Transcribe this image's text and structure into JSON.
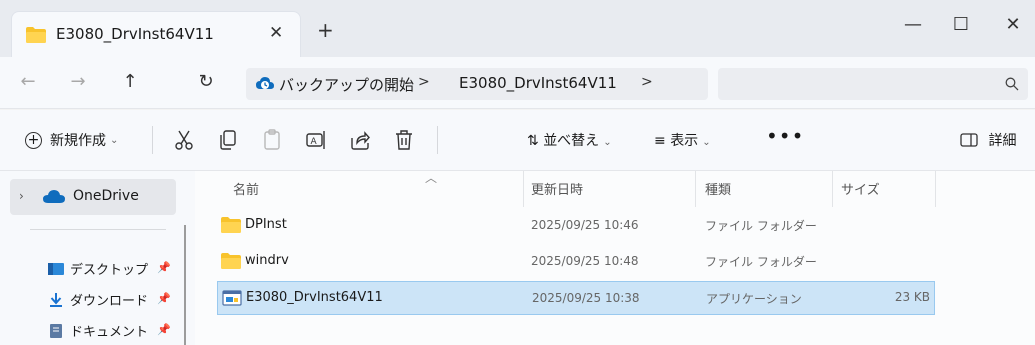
{
  "window": {
    "tab_title": "E3080_DrvInst64V11",
    "tab_close": "✕",
    "new_tab": "+",
    "minimize": "—",
    "maximize": "☐",
    "close": "✕"
  },
  "address": {
    "back": "←",
    "forward": "→",
    "up": "↑",
    "refresh": "↻",
    "breadcrumb": [
      "バックアップの開始",
      "E3080_DrvInst64V11"
    ],
    "separator": ">"
  },
  "toolbar": {
    "new_label": "新規作成",
    "chevron": "⌄",
    "sort_label": "並べ替え",
    "view_label": "表示",
    "more": "•••",
    "details_label": "詳細"
  },
  "sidebar": {
    "onedrive": "OneDrive",
    "items": [
      {
        "label": "デスクトップ",
        "icon": "desktop-icon"
      },
      {
        "label": "ダウンロード",
        "icon": "download-icon"
      },
      {
        "label": "ドキュメント",
        "icon": "document-icon"
      }
    ]
  },
  "columns": {
    "name": "名前",
    "date": "更新日時",
    "type": "種類",
    "size": "サイズ"
  },
  "files": [
    {
      "name": "DPInst",
      "date": "2025/09/25 10:46",
      "type": "ファイル フォルダー",
      "size": "",
      "icon": "folder-icon"
    },
    {
      "name": "windrv",
      "date": "2025/09/25 10:48",
      "type": "ファイル フォルダー",
      "size": "",
      "icon": "folder-icon"
    },
    {
      "name": "E3080_DrvInst64V11",
      "date": "2025/09/25 10:38",
      "type": "アプリケーション",
      "size": "23 KB",
      "icon": "application-icon",
      "selected": true
    }
  ],
  "colors": {
    "selection": "#cce4f7",
    "folder": "#f8c32c",
    "accent": "#0f6cbd"
  }
}
